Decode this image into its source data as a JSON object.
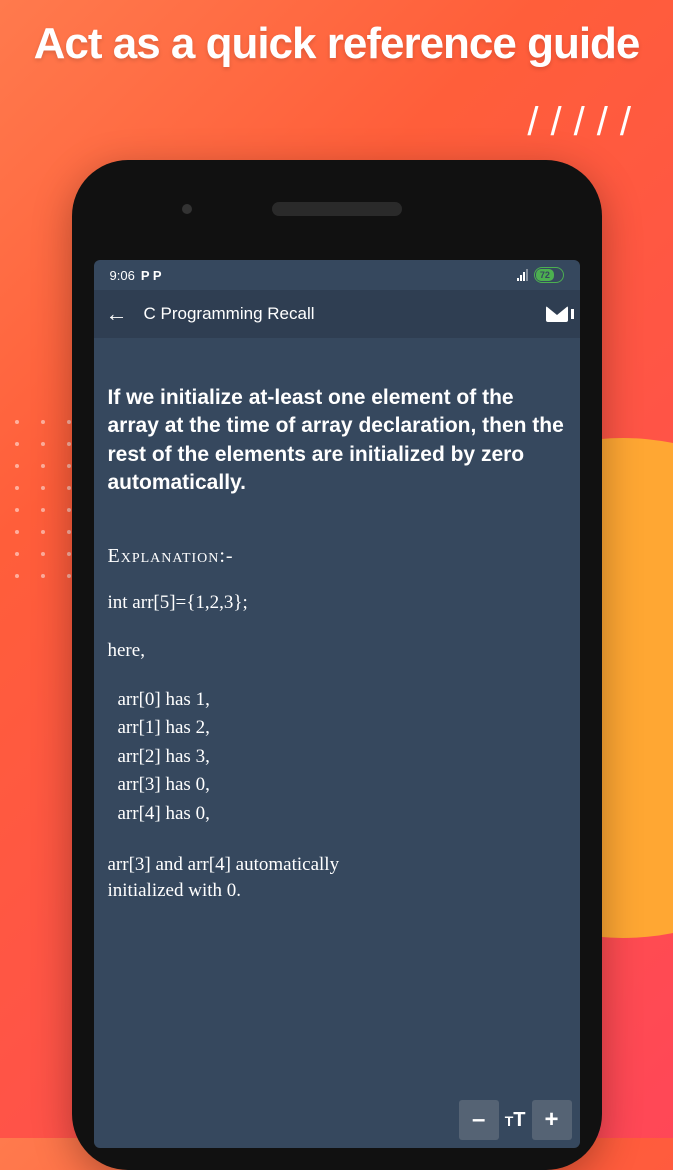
{
  "promo": {
    "headline": "Act as a quick reference guide"
  },
  "statusBar": {
    "time": "9:06",
    "icons": "P  P",
    "battery": "72"
  },
  "appBar": {
    "title": "C Programming Recall"
  },
  "content": {
    "concept": "If we initialize at-least one element of the array at the time of array declaration, then the rest of the elements are initialized by zero automatically.",
    "explanationLabel": "Explanation:-",
    "codeDecl": "int arr[5]={1,2,3};",
    "here": "here,",
    "arr0": "arr[0] has 1,",
    "arr1": "arr[1] has 2,",
    "arr2": "arr[2] has 3,",
    "arr3": "arr[3] has 0,",
    "arr4": "arr[4] has 0,",
    "conclusion1": " arr[3] and arr[4] automatically",
    "conclusion2": "initialized with 0."
  },
  "controls": {
    "minus": "–",
    "plus": "+",
    "ttSmall": "T",
    "ttBig": "T"
  }
}
